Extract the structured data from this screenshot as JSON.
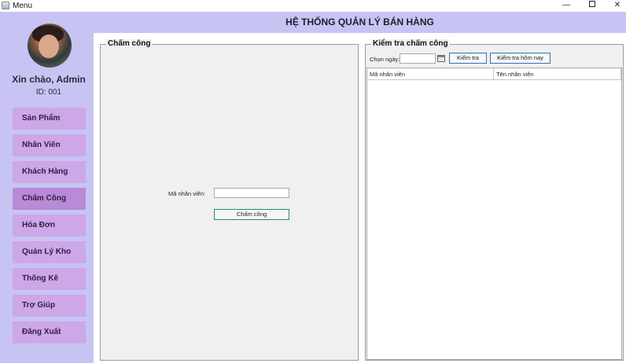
{
  "window": {
    "title": "Menu",
    "minimize": "—",
    "close": "✕"
  },
  "header": {
    "title": "HỆ THỐNG QUẢN LÝ BÁN HÀNG"
  },
  "user": {
    "greeting": "Xin chào, Admin",
    "id_label": "ID: 001"
  },
  "sidebar": {
    "items": [
      {
        "label": "Sản Phẩm"
      },
      {
        "label": "Nhân Viên"
      },
      {
        "label": "Khách Hàng"
      },
      {
        "label": "Chấm Công"
      },
      {
        "label": "Hóa Đơn"
      },
      {
        "label": "Quản Lý Kho"
      },
      {
        "label": "Thống Kê"
      },
      {
        "label": "Trợ Giúp"
      },
      {
        "label": "Đăng Xuất"
      }
    ],
    "active_index": 3
  },
  "attendance": {
    "title": "Chấm công",
    "employee_id_label": "Mã nhân viên:",
    "employee_id_value": "",
    "submit_label": "Chấm công"
  },
  "check": {
    "title": "Kiểm tra chấm công",
    "date_label": "Chọn ngày:",
    "date_value": "",
    "check_button": "Kiểm tra",
    "today_button": "Kiểm tra hôm nay",
    "table": {
      "columns": [
        "Mã nhân viên",
        "Tên nhân viên"
      ],
      "rows": []
    }
  },
  "colors": {
    "sidebar_bg": "#c7c4f3",
    "nav_item": "#cda7e8",
    "nav_active": "#b88ad8"
  }
}
